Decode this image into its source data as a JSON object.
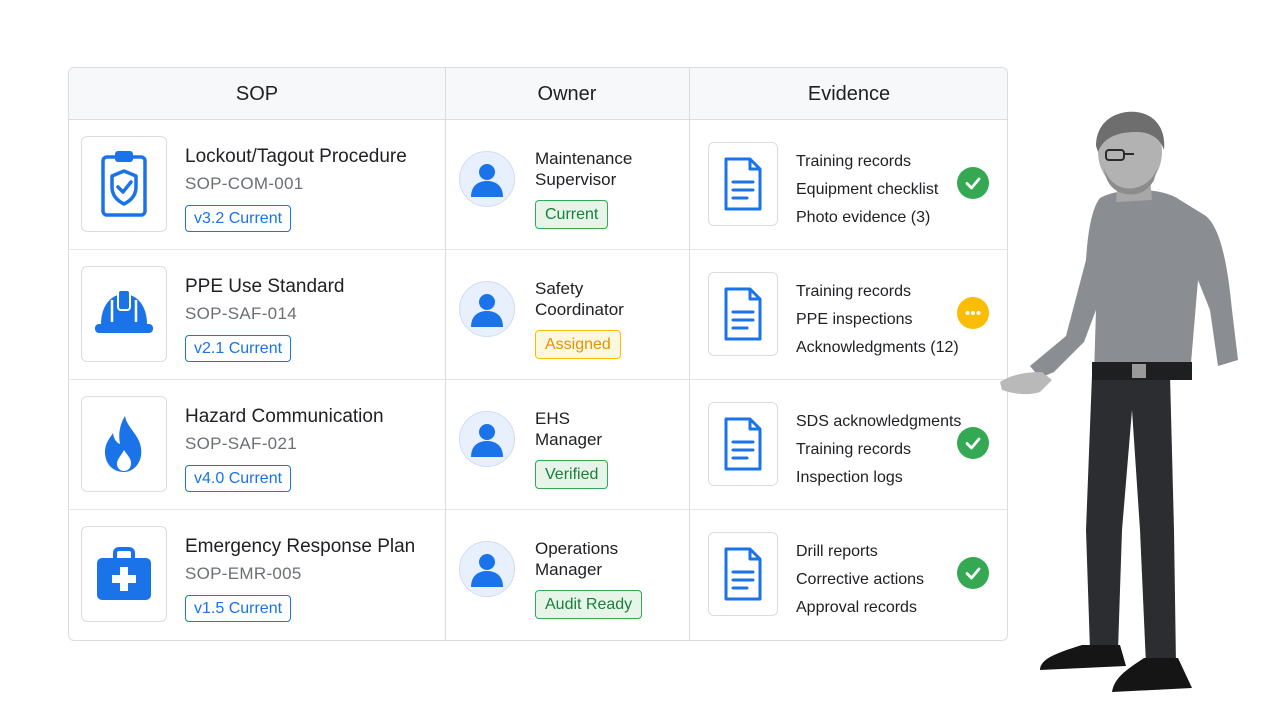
{
  "table": {
    "headers": [
      "SOP",
      "Owner",
      "Evidence"
    ],
    "rows": [
      {
        "icon": "clipboard-shield-icon",
        "title": "Lockout/Tagout Procedure",
        "code": "SOP-COM-001",
        "version": "v3.2 Current",
        "owner": [
          "Maintenance",
          "Supervisor"
        ],
        "status": "Current",
        "status_type": "green",
        "evidence": [
          "Training records",
          "Equipment checklist",
          "Photo evidence (3)"
        ],
        "evidence_status": "complete"
      },
      {
        "icon": "hard-hat-icon",
        "title": "PPE Use Standard",
        "code": "SOP-SAF-014",
        "version": "v2.1 Current",
        "owner": [
          "Safety",
          "Coordinator"
        ],
        "status": "Assigned",
        "status_type": "amber",
        "evidence": [
          "Training records",
          "PPE inspections",
          "Acknowledgments (12)"
        ],
        "evidence_status": "pending"
      },
      {
        "icon": "flame-icon",
        "title": "Hazard Communication",
        "code": "SOP-SAF-021",
        "version": "v4.0 Current",
        "owner": [
          "EHS",
          "Manager"
        ],
        "status": "Verified",
        "status_type": "green",
        "evidence": [
          "SDS acknowledgments",
          "Training records",
          "Inspection logs"
        ],
        "evidence_status": "complete"
      },
      {
        "icon": "first-aid-kit-icon",
        "title": "Emergency Response Plan",
        "code": "SOP-EMR-005",
        "version": "v1.5 Current",
        "owner": [
          "Operations",
          "Manager"
        ],
        "status": "Audit Ready",
        "status_type": "green",
        "evidence": [
          "Drill reports",
          "Corrective actions",
          "Approval records"
        ],
        "evidence_status": "complete"
      }
    ]
  },
  "colors": {
    "accent_blue": "#1a73e8",
    "success_green": "#34a853",
    "pending_amber": "#fbbc04",
    "border": "#dadce0"
  }
}
